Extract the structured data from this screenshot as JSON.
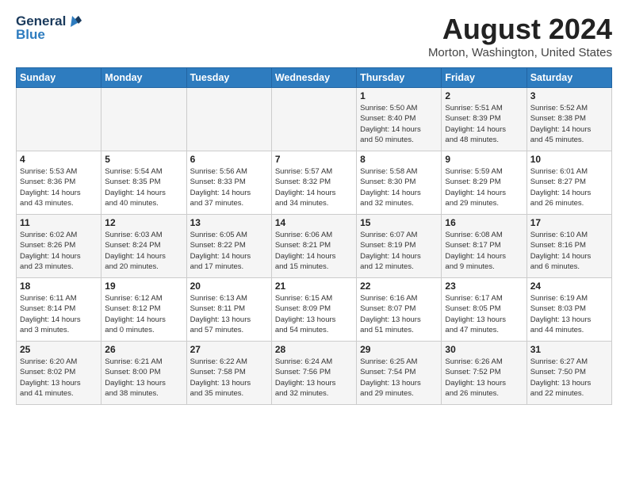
{
  "header": {
    "logo_line1": "General",
    "logo_line2": "Blue",
    "month": "August 2024",
    "location": "Morton, Washington, United States"
  },
  "days_of_week": [
    "Sunday",
    "Monday",
    "Tuesday",
    "Wednesday",
    "Thursday",
    "Friday",
    "Saturday"
  ],
  "weeks": [
    [
      {
        "day": "",
        "info": ""
      },
      {
        "day": "",
        "info": ""
      },
      {
        "day": "",
        "info": ""
      },
      {
        "day": "",
        "info": ""
      },
      {
        "day": "1",
        "info": "Sunrise: 5:50 AM\nSunset: 8:40 PM\nDaylight: 14 hours\nand 50 minutes."
      },
      {
        "day": "2",
        "info": "Sunrise: 5:51 AM\nSunset: 8:39 PM\nDaylight: 14 hours\nand 48 minutes."
      },
      {
        "day": "3",
        "info": "Sunrise: 5:52 AM\nSunset: 8:38 PM\nDaylight: 14 hours\nand 45 minutes."
      }
    ],
    [
      {
        "day": "4",
        "info": "Sunrise: 5:53 AM\nSunset: 8:36 PM\nDaylight: 14 hours\nand 43 minutes."
      },
      {
        "day": "5",
        "info": "Sunrise: 5:54 AM\nSunset: 8:35 PM\nDaylight: 14 hours\nand 40 minutes."
      },
      {
        "day": "6",
        "info": "Sunrise: 5:56 AM\nSunset: 8:33 PM\nDaylight: 14 hours\nand 37 minutes."
      },
      {
        "day": "7",
        "info": "Sunrise: 5:57 AM\nSunset: 8:32 PM\nDaylight: 14 hours\nand 34 minutes."
      },
      {
        "day": "8",
        "info": "Sunrise: 5:58 AM\nSunset: 8:30 PM\nDaylight: 14 hours\nand 32 minutes."
      },
      {
        "day": "9",
        "info": "Sunrise: 5:59 AM\nSunset: 8:29 PM\nDaylight: 14 hours\nand 29 minutes."
      },
      {
        "day": "10",
        "info": "Sunrise: 6:01 AM\nSunset: 8:27 PM\nDaylight: 14 hours\nand 26 minutes."
      }
    ],
    [
      {
        "day": "11",
        "info": "Sunrise: 6:02 AM\nSunset: 8:26 PM\nDaylight: 14 hours\nand 23 minutes."
      },
      {
        "day": "12",
        "info": "Sunrise: 6:03 AM\nSunset: 8:24 PM\nDaylight: 14 hours\nand 20 minutes."
      },
      {
        "day": "13",
        "info": "Sunrise: 6:05 AM\nSunset: 8:22 PM\nDaylight: 14 hours\nand 17 minutes."
      },
      {
        "day": "14",
        "info": "Sunrise: 6:06 AM\nSunset: 8:21 PM\nDaylight: 14 hours\nand 15 minutes."
      },
      {
        "day": "15",
        "info": "Sunrise: 6:07 AM\nSunset: 8:19 PM\nDaylight: 14 hours\nand 12 minutes."
      },
      {
        "day": "16",
        "info": "Sunrise: 6:08 AM\nSunset: 8:17 PM\nDaylight: 14 hours\nand 9 minutes."
      },
      {
        "day": "17",
        "info": "Sunrise: 6:10 AM\nSunset: 8:16 PM\nDaylight: 14 hours\nand 6 minutes."
      }
    ],
    [
      {
        "day": "18",
        "info": "Sunrise: 6:11 AM\nSunset: 8:14 PM\nDaylight: 14 hours\nand 3 minutes."
      },
      {
        "day": "19",
        "info": "Sunrise: 6:12 AM\nSunset: 8:12 PM\nDaylight: 14 hours\nand 0 minutes."
      },
      {
        "day": "20",
        "info": "Sunrise: 6:13 AM\nSunset: 8:11 PM\nDaylight: 13 hours\nand 57 minutes."
      },
      {
        "day": "21",
        "info": "Sunrise: 6:15 AM\nSunset: 8:09 PM\nDaylight: 13 hours\nand 54 minutes."
      },
      {
        "day": "22",
        "info": "Sunrise: 6:16 AM\nSunset: 8:07 PM\nDaylight: 13 hours\nand 51 minutes."
      },
      {
        "day": "23",
        "info": "Sunrise: 6:17 AM\nSunset: 8:05 PM\nDaylight: 13 hours\nand 47 minutes."
      },
      {
        "day": "24",
        "info": "Sunrise: 6:19 AM\nSunset: 8:03 PM\nDaylight: 13 hours\nand 44 minutes."
      }
    ],
    [
      {
        "day": "25",
        "info": "Sunrise: 6:20 AM\nSunset: 8:02 PM\nDaylight: 13 hours\nand 41 minutes."
      },
      {
        "day": "26",
        "info": "Sunrise: 6:21 AM\nSunset: 8:00 PM\nDaylight: 13 hours\nand 38 minutes."
      },
      {
        "day": "27",
        "info": "Sunrise: 6:22 AM\nSunset: 7:58 PM\nDaylight: 13 hours\nand 35 minutes."
      },
      {
        "day": "28",
        "info": "Sunrise: 6:24 AM\nSunset: 7:56 PM\nDaylight: 13 hours\nand 32 minutes."
      },
      {
        "day": "29",
        "info": "Sunrise: 6:25 AM\nSunset: 7:54 PM\nDaylight: 13 hours\nand 29 minutes."
      },
      {
        "day": "30",
        "info": "Sunrise: 6:26 AM\nSunset: 7:52 PM\nDaylight: 13 hours\nand 26 minutes."
      },
      {
        "day": "31",
        "info": "Sunrise: 6:27 AM\nSunset: 7:50 PM\nDaylight: 13 hours\nand 22 minutes."
      }
    ]
  ]
}
